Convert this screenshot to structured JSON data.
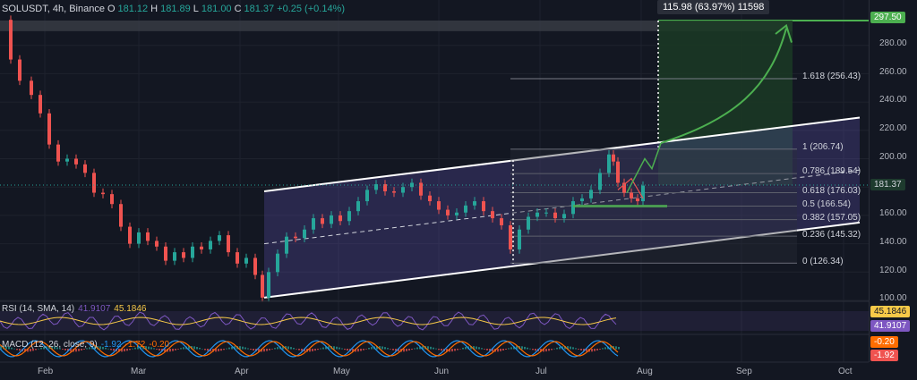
{
  "header": {
    "symbol": "SOLUSDT, 4h, Binance",
    "open_k": "O",
    "open": "181.12",
    "high_k": "H",
    "high": "181.89",
    "low_k": "L",
    "low": "181.00",
    "close_k": "C",
    "close": "181.37",
    "change": "+0.25 (+0.14%)"
  },
  "measure": {
    "text": "115.98 (63.97%) 11598"
  },
  "price_axis": {
    "ticks": [
      "280.00",
      "260.00",
      "240.00",
      "220.00",
      "200.00",
      "180.00",
      "160.00",
      "140.00",
      "120.00",
      "100.00"
    ],
    "target_badge": "297.50",
    "current_badge": "181.37"
  },
  "fib_levels": [
    {
      "label": "1.618 (256.43)"
    },
    {
      "label": "1 (206.74)"
    },
    {
      "label": "0.786 (189.54)"
    },
    {
      "label": "0.618 (176.03)"
    },
    {
      "label": "0.5 (166.54)"
    },
    {
      "label": "0.382 (157.05)"
    },
    {
      "label": "0.236 (145.32)"
    },
    {
      "label": "0 (126.34)"
    }
  ],
  "rsi": {
    "name": "RSI (14, SMA, 14)",
    "value": "41.9107",
    "sma": "45.1846",
    "badge_sma": "45.1846",
    "badge_value": "41.9107"
  },
  "macd": {
    "name": "MACD (12, 26, close, 9)",
    "macd": "-1.92",
    "signal": "-1.72",
    "hist": "-0.20",
    "badge_hist": "-0.20",
    "badge_macd": "-1.92"
  },
  "time_axis": {
    "labels": [
      "Feb",
      "Mar",
      "Apr",
      "May",
      "Jun",
      "Jul",
      "Aug",
      "Sep",
      "Oct"
    ]
  },
  "colors": {
    "background": "#131722",
    "up": "#26a69a",
    "down": "#ef5350",
    "channel": "#6a5acd",
    "target_green": "#4caf50",
    "rsi_line": "#7e57c2",
    "rsi_sma": "#f7c948"
  },
  "chart_data": {
    "type": "candlestick",
    "price_range": [
      100,
      300
    ]
  }
}
